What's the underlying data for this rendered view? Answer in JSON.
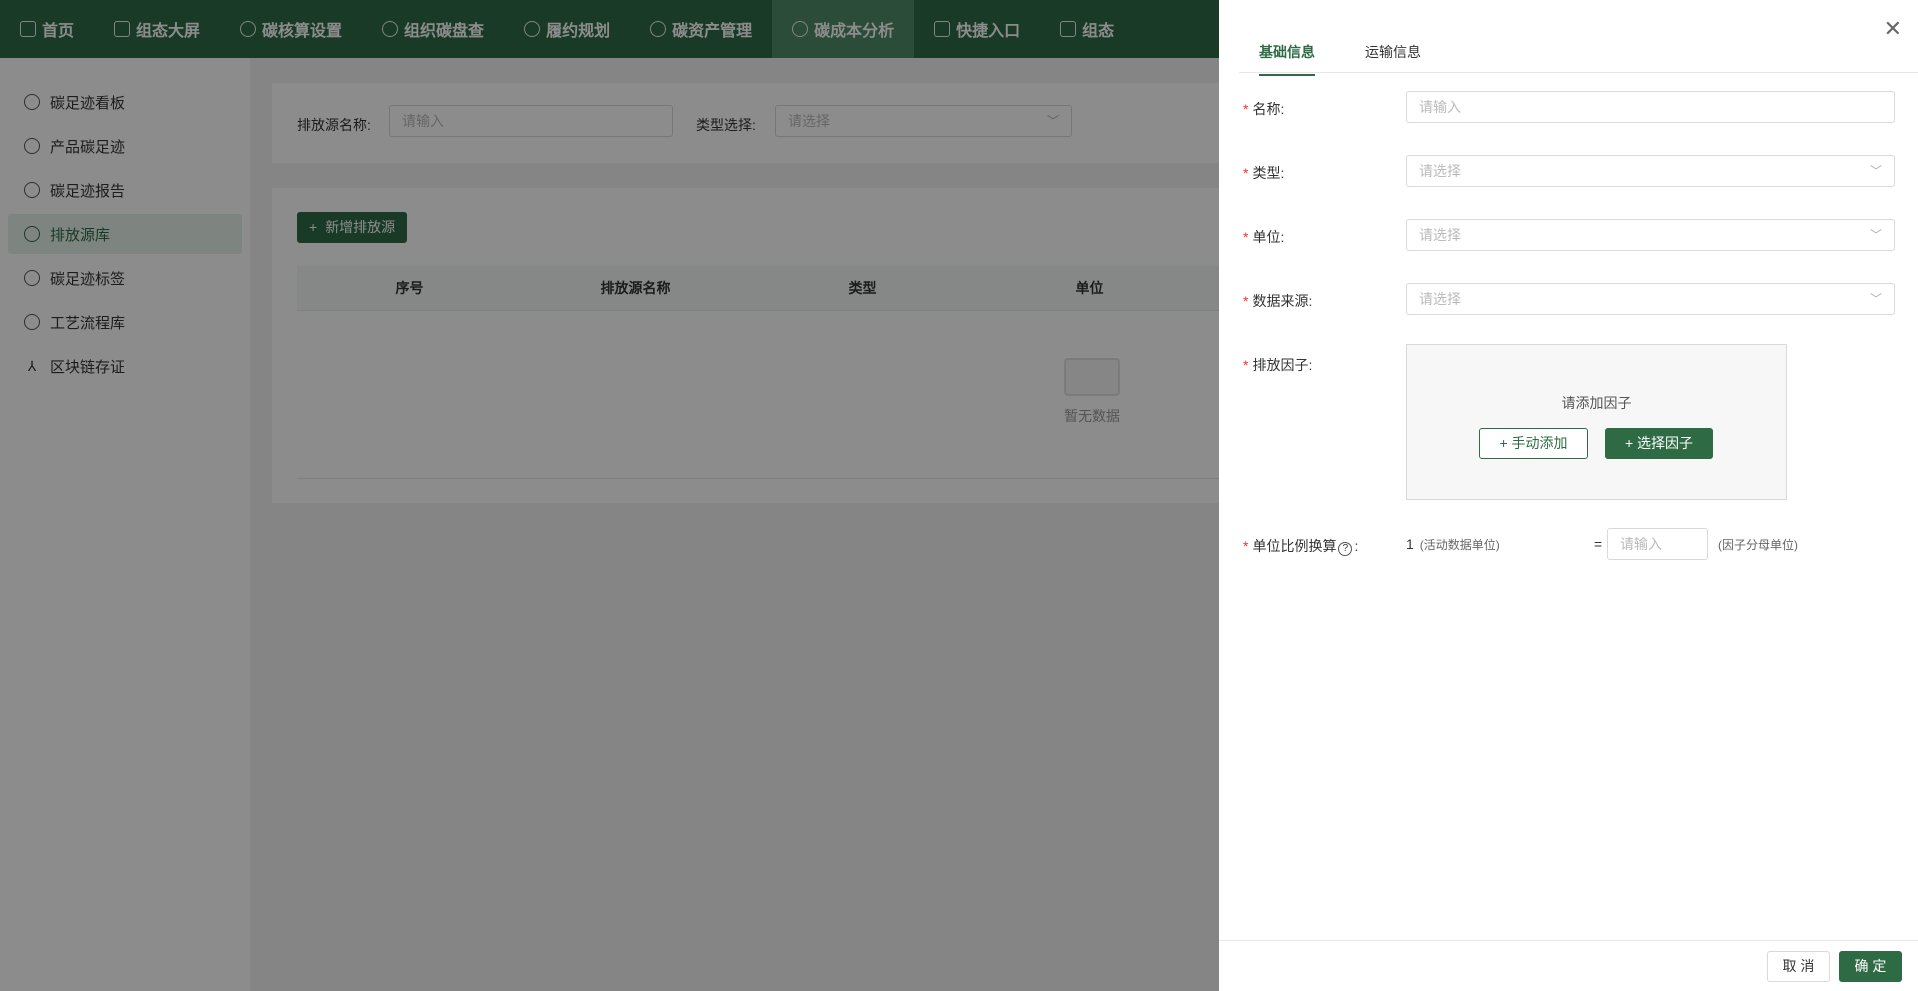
{
  "topnav": {
    "items": [
      {
        "label": "首页",
        "icon": "home-icon"
      },
      {
        "label": "组态大屏",
        "icon": "chart-icon"
      },
      {
        "label": "碳核算设置",
        "icon": "settings-icon"
      },
      {
        "label": "组织碳盘查",
        "icon": "search-icon"
      },
      {
        "label": "履约规划",
        "icon": "plan-icon"
      },
      {
        "label": "碳资产管理",
        "icon": "asset-icon"
      },
      {
        "label": "碳成本分析",
        "icon": "cost-icon"
      },
      {
        "label": "快捷入口",
        "icon": "shortcut-icon"
      },
      {
        "label": "组态",
        "icon": "config-icon"
      }
    ],
    "active_index": 6
  },
  "sidebar": {
    "items": [
      {
        "label": "碳足迹看板"
      },
      {
        "label": "产品碳足迹"
      },
      {
        "label": "碳足迹报告"
      },
      {
        "label": "排放源库"
      },
      {
        "label": "碳足迹标签"
      },
      {
        "label": "工艺流程库"
      },
      {
        "label": "区块链存证"
      }
    ],
    "active_index": 3
  },
  "filter": {
    "name_label": "排放源名称:",
    "name_placeholder": "请输入",
    "type_label": "类型选择:",
    "type_placeholder": "请选择"
  },
  "table": {
    "add_button": "新增排放源",
    "columns": [
      "序号",
      "排放源名称",
      "类型",
      "单位"
    ],
    "empty_text": "暂无数据"
  },
  "drawer": {
    "tabs": [
      "基础信息",
      "运输信息"
    ],
    "active_tab": 0,
    "fields": {
      "name": {
        "label": "名称:",
        "placeholder": "请输入"
      },
      "type": {
        "label": "类型:",
        "placeholder": "请选择"
      },
      "unit": {
        "label": "单位:",
        "placeholder": "请选择"
      },
      "source": {
        "label": "数据来源:",
        "placeholder": "请选择"
      },
      "factor": {
        "label": "排放因子:",
        "hint": "请添加因子",
        "manual_button": "手动添加",
        "select_button": "选择因子"
      },
      "ratio": {
        "label": "单位比例换算",
        "colon": ":",
        "value_one": "1",
        "activity_unit": "(活动数据单位)",
        "equals": "=",
        "placeholder": "请输入",
        "factor_unit": "(因子分母单位)"
      }
    },
    "cancel_button": "取 消",
    "ok_button": "确 定"
  },
  "colors": {
    "brand": "#2e6b45",
    "required": "#e33"
  }
}
